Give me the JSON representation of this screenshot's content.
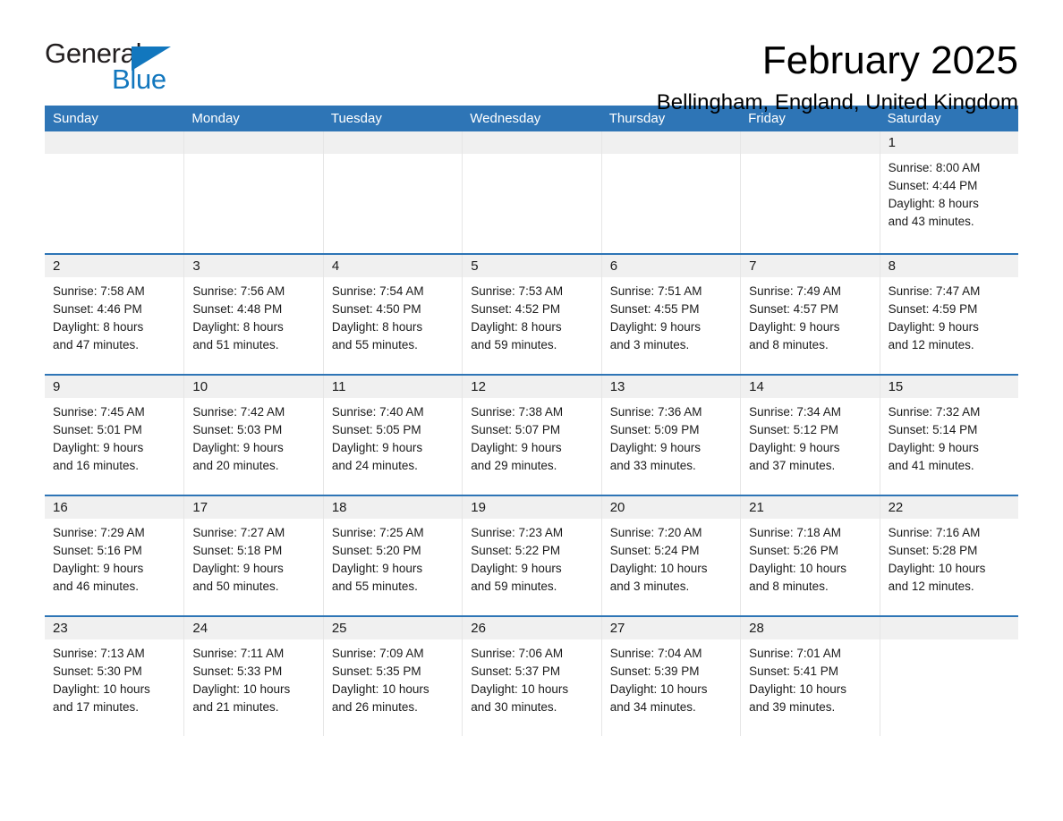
{
  "brand": {
    "name_part1": "General",
    "name_part2": "Blue",
    "accent_color": "#1277be"
  },
  "header": {
    "title": "February 2025",
    "subtitle": "Bellingham, England, United Kingdom"
  },
  "theme": {
    "header_blue": "#2e75b6",
    "daynum_band": "#f0f0f0"
  },
  "calendar": {
    "daynames": [
      "Sunday",
      "Monday",
      "Tuesday",
      "Wednesday",
      "Thursday",
      "Friday",
      "Saturday"
    ],
    "weeks": [
      [
        {
          "day": "",
          "empty": true
        },
        {
          "day": "",
          "empty": true
        },
        {
          "day": "",
          "empty": true
        },
        {
          "day": "",
          "empty": true
        },
        {
          "day": "",
          "empty": true
        },
        {
          "day": "",
          "empty": true
        },
        {
          "day": "1",
          "sunrise": "Sunrise: 8:00 AM",
          "sunset": "Sunset: 4:44 PM",
          "daylight1": "Daylight: 8 hours",
          "daylight2": "and 43 minutes."
        }
      ],
      [
        {
          "day": "2",
          "sunrise": "Sunrise: 7:58 AM",
          "sunset": "Sunset: 4:46 PM",
          "daylight1": "Daylight: 8 hours",
          "daylight2": "and 47 minutes."
        },
        {
          "day": "3",
          "sunrise": "Sunrise: 7:56 AM",
          "sunset": "Sunset: 4:48 PM",
          "daylight1": "Daylight: 8 hours",
          "daylight2": "and 51 minutes."
        },
        {
          "day": "4",
          "sunrise": "Sunrise: 7:54 AM",
          "sunset": "Sunset: 4:50 PM",
          "daylight1": "Daylight: 8 hours",
          "daylight2": "and 55 minutes."
        },
        {
          "day": "5",
          "sunrise": "Sunrise: 7:53 AM",
          "sunset": "Sunset: 4:52 PM",
          "daylight1": "Daylight: 8 hours",
          "daylight2": "and 59 minutes."
        },
        {
          "day": "6",
          "sunrise": "Sunrise: 7:51 AM",
          "sunset": "Sunset: 4:55 PM",
          "daylight1": "Daylight: 9 hours",
          "daylight2": "and 3 minutes."
        },
        {
          "day": "7",
          "sunrise": "Sunrise: 7:49 AM",
          "sunset": "Sunset: 4:57 PM",
          "daylight1": "Daylight: 9 hours",
          "daylight2": "and 8 minutes."
        },
        {
          "day": "8",
          "sunrise": "Sunrise: 7:47 AM",
          "sunset": "Sunset: 4:59 PM",
          "daylight1": "Daylight: 9 hours",
          "daylight2": "and 12 minutes."
        }
      ],
      [
        {
          "day": "9",
          "sunrise": "Sunrise: 7:45 AM",
          "sunset": "Sunset: 5:01 PM",
          "daylight1": "Daylight: 9 hours",
          "daylight2": "and 16 minutes."
        },
        {
          "day": "10",
          "sunrise": "Sunrise: 7:42 AM",
          "sunset": "Sunset: 5:03 PM",
          "daylight1": "Daylight: 9 hours",
          "daylight2": "and 20 minutes."
        },
        {
          "day": "11",
          "sunrise": "Sunrise: 7:40 AM",
          "sunset": "Sunset: 5:05 PM",
          "daylight1": "Daylight: 9 hours",
          "daylight2": "and 24 minutes."
        },
        {
          "day": "12",
          "sunrise": "Sunrise: 7:38 AM",
          "sunset": "Sunset: 5:07 PM",
          "daylight1": "Daylight: 9 hours",
          "daylight2": "and 29 minutes."
        },
        {
          "day": "13",
          "sunrise": "Sunrise: 7:36 AM",
          "sunset": "Sunset: 5:09 PM",
          "daylight1": "Daylight: 9 hours",
          "daylight2": "and 33 minutes."
        },
        {
          "day": "14",
          "sunrise": "Sunrise: 7:34 AM",
          "sunset": "Sunset: 5:12 PM",
          "daylight1": "Daylight: 9 hours",
          "daylight2": "and 37 minutes."
        },
        {
          "day": "15",
          "sunrise": "Sunrise: 7:32 AM",
          "sunset": "Sunset: 5:14 PM",
          "daylight1": "Daylight: 9 hours",
          "daylight2": "and 41 minutes."
        }
      ],
      [
        {
          "day": "16",
          "sunrise": "Sunrise: 7:29 AM",
          "sunset": "Sunset: 5:16 PM",
          "daylight1": "Daylight: 9 hours",
          "daylight2": "and 46 minutes."
        },
        {
          "day": "17",
          "sunrise": "Sunrise: 7:27 AM",
          "sunset": "Sunset: 5:18 PM",
          "daylight1": "Daylight: 9 hours",
          "daylight2": "and 50 minutes."
        },
        {
          "day": "18",
          "sunrise": "Sunrise: 7:25 AM",
          "sunset": "Sunset: 5:20 PM",
          "daylight1": "Daylight: 9 hours",
          "daylight2": "and 55 minutes."
        },
        {
          "day": "19",
          "sunrise": "Sunrise: 7:23 AM",
          "sunset": "Sunset: 5:22 PM",
          "daylight1": "Daylight: 9 hours",
          "daylight2": "and 59 minutes."
        },
        {
          "day": "20",
          "sunrise": "Sunrise: 7:20 AM",
          "sunset": "Sunset: 5:24 PM",
          "daylight1": "Daylight: 10 hours",
          "daylight2": "and 3 minutes."
        },
        {
          "day": "21",
          "sunrise": "Sunrise: 7:18 AM",
          "sunset": "Sunset: 5:26 PM",
          "daylight1": "Daylight: 10 hours",
          "daylight2": "and 8 minutes."
        },
        {
          "day": "22",
          "sunrise": "Sunrise: 7:16 AM",
          "sunset": "Sunset: 5:28 PM",
          "daylight1": "Daylight: 10 hours",
          "daylight2": "and 12 minutes."
        }
      ],
      [
        {
          "day": "23",
          "sunrise": "Sunrise: 7:13 AM",
          "sunset": "Sunset: 5:30 PM",
          "daylight1": "Daylight: 10 hours",
          "daylight2": "and 17 minutes."
        },
        {
          "day": "24",
          "sunrise": "Sunrise: 7:11 AM",
          "sunset": "Sunset: 5:33 PM",
          "daylight1": "Daylight: 10 hours",
          "daylight2": "and 21 minutes."
        },
        {
          "day": "25",
          "sunrise": "Sunrise: 7:09 AM",
          "sunset": "Sunset: 5:35 PM",
          "daylight1": "Daylight: 10 hours",
          "daylight2": "and 26 minutes."
        },
        {
          "day": "26",
          "sunrise": "Sunrise: 7:06 AM",
          "sunset": "Sunset: 5:37 PM",
          "daylight1": "Daylight: 10 hours",
          "daylight2": "and 30 minutes."
        },
        {
          "day": "27",
          "sunrise": "Sunrise: 7:04 AM",
          "sunset": "Sunset: 5:39 PM",
          "daylight1": "Daylight: 10 hours",
          "daylight2": "and 34 minutes."
        },
        {
          "day": "28",
          "sunrise": "Sunrise: 7:01 AM",
          "sunset": "Sunset: 5:41 PM",
          "daylight1": "Daylight: 10 hours",
          "daylight2": "and 39 minutes."
        },
        {
          "day": "",
          "empty": true
        }
      ]
    ]
  }
}
